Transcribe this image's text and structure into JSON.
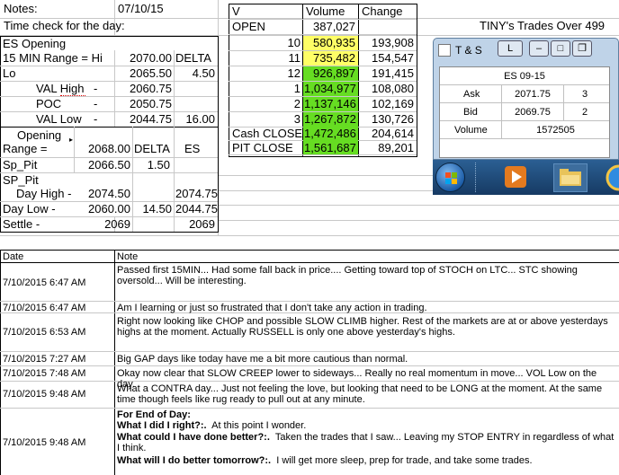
{
  "header": {
    "notes_label": "Notes:",
    "date": "07/10/15",
    "time_check_label": "Time check for the day:",
    "title": "TINY's Trades Over 499"
  },
  "es_opening": {
    "title": "ES Opening",
    "range_label": "15 MIN Range = Hi",
    "hi_value": "2070.00",
    "delta_label": "DELTA",
    "lo_label": "Lo",
    "lo_value": "2065.50",
    "lo_delta": "4.50",
    "val_high_label": "VAL High",
    "val_high_dash": "-",
    "val_high_value": "2060.75",
    "poc_label": "POC",
    "poc_dash": "-",
    "poc_value": "2050.75",
    "val_low_label": "VAL Low",
    "val_low_dash": "-",
    "val_low_value": "2044.75",
    "val_low_delta": "16.00"
  },
  "opening_range": {
    "opening_label": "Opening",
    "range_label": "Range =",
    "range_value": "2068.00",
    "delta_label": "DELTA",
    "es_label": "ES",
    "sp_pit_label": "Sp_Pit",
    "sp_pit_value": "2066.50",
    "sp_pit_delta": "1.50",
    "sp_pit2_label": "SP_Pit",
    "day_high_label": "Day High -",
    "day_high_value": "2074.50",
    "day_high_es": "2074.75",
    "day_low_label": "Day Low -",
    "day_low_value": "2060.00",
    "day_low_delta": "14.50",
    "day_low_es": "2044.75",
    "settle_label": "Settle -",
    "settle_value": "2069",
    "settle_es": "2069"
  },
  "volume_table": {
    "col_v": "V",
    "col_volume": "Volume",
    "col_change": "Change",
    "open_label": "OPEN",
    "open_volume": "387,027",
    "rows": [
      {
        "label": "10",
        "volume": "580,935",
        "change": "193,908",
        "color": "#ffff66"
      },
      {
        "label": "11",
        "volume": "735,482",
        "change": "154,547",
        "color": "#ffff66"
      },
      {
        "label": "12",
        "volume": "926,897",
        "change": "191,415",
        "color": "#66dd22"
      },
      {
        "label": "1",
        "volume": "1,034,977",
        "change": "108,080",
        "color": "#66dd22"
      },
      {
        "label": "2",
        "volume": "1,137,146",
        "change": "102,169",
        "color": "#66dd22"
      },
      {
        "label": "3",
        "volume": "1,267,872",
        "change": "130,726",
        "color": "#66dd22"
      }
    ],
    "cash_close_label": "Cash CLOSE",
    "cash_close_volume": "1,472,486",
    "cash_close_change": "204,614",
    "pit_close_label": "PIT CLOSE",
    "pit_close_volume": "1,561,687",
    "pit_close_change": "89,201"
  },
  "ts_window": {
    "title": "T & S",
    "l_button": "L",
    "symbol": "ES 09-15",
    "ask_label": "Ask",
    "ask_price": "2071.75",
    "ask_size": "3",
    "bid_label": "Bid",
    "bid_price": "2069.75",
    "bid_size": "2",
    "volume_label": "Volume",
    "volume_value": "1572505"
  },
  "notes_table": {
    "col_date": "Date",
    "col_note": "Note",
    "rows": [
      {
        "date": "7/10/2015 6:47 AM",
        "note": "Passed first 15MIN... Had some fall back in price.... Getting toward top of STOCH on LTC... STC showing oversold... Will be interesting."
      },
      {
        "date": "7/10/2015 6:47 AM",
        "note": "Am I learning or just so frustrated that I don't take any action in trading."
      },
      {
        "date": "7/10/2015 6:53 AM",
        "note": "Right now looking like CHOP and possible SLOW CLIMB higher.  Rest of the markets are at or above yesterdays highs at the moment.  Actually RUSSELL is only one above yesterday's highs."
      },
      {
        "date": "7/10/2015 7:27 AM",
        "note": "Big GAP days like today have me a bit more cautious than normal."
      },
      {
        "date": "7/10/2015 7:48 AM",
        "note": "Okay now clear that SLOW CREEP lower to sideways... Really no real momentum in move... VOL Low on the day."
      },
      {
        "date": "7/10/2015 9:48 AM",
        "note": "What a CONTRA day... Just not feeling the love, but looking that need to be LONG at the moment.  At the same time though feels like rug ready to pull out at any minute."
      }
    ],
    "last_row": {
      "date": "7/10/2015 9:48 AM",
      "end_of_day": "For End of Day:",
      "q1": "What I did I right?:.",
      "a1": "At this point I wonder.",
      "q2": "What could I have done better?:.",
      "a2": "Taken the trades that I saw... Leaving my STOP ENTRY in regardless of what I think.",
      "q3": "What will I do better tomorrow?:.",
      "a3": "I will get more sleep, prep for trade, and take some trades."
    }
  }
}
